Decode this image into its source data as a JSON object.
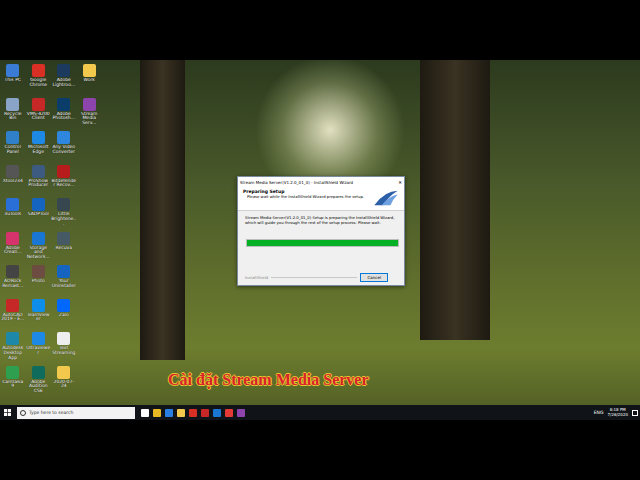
{
  "desktop": {
    "icons": [
      {
        "label": "This PC",
        "color": "#3a7bd5"
      },
      {
        "label": "Recycle Bin",
        "color": "#8aa4c8"
      },
      {
        "label": "Control Panel",
        "color": "#2f80c8"
      },
      {
        "label": "Xtool234",
        "color": "#555555"
      },
      {
        "label": "3uTools",
        "color": "#2a6fd6"
      },
      {
        "label": "Adobe Creati...",
        "color": "#d6336c"
      },
      {
        "label": "AORock Remast...",
        "color": "#444444"
      },
      {
        "label": "AutoCAD 2019 - E...",
        "color": "#c62828"
      },
      {
        "label": "Autodesk Desktop App",
        "color": "#1e88a8"
      },
      {
        "label": "Camtasia 9",
        "color": "#2e9e4f"
      },
      {
        "label": "Google Chrome",
        "color": "#d93025"
      },
      {
        "label": "VMS-4200 Client",
        "color": "#c62828"
      },
      {
        "label": "Microsoft Edge",
        "color": "#1e88e5"
      },
      {
        "label": "ProShow Producer",
        "color": "#3d5a80"
      },
      {
        "label": "SADPTool",
        "color": "#1565c0"
      },
      {
        "label": "Storage and Network...",
        "color": "#1976d2"
      },
      {
        "label": "Photo",
        "color": "#6d4c41"
      },
      {
        "label": "TeamViewer",
        "color": "#0e8ee9"
      },
      {
        "label": "Ultraviewer",
        "color": "#1e88e5"
      },
      {
        "label": "Adobe Audition CS6",
        "color": "#0f6b5c"
      },
      {
        "label": "Adobe Lightroo...",
        "color": "#1c3a5e"
      },
      {
        "label": "Adobe Photosh...",
        "color": "#0b3d6b"
      },
      {
        "label": "Any Video Converter",
        "color": "#2e86de"
      },
      {
        "label": "Bitdefender Recov...",
        "color": "#b71c1c"
      },
      {
        "label": "Little Brightene...",
        "color": "#37474f"
      },
      {
        "label": "Recuva",
        "color": "#455a64"
      },
      {
        "label": "Your Uninstaller",
        "color": "#1565c0"
      },
      {
        "label": "Zalo",
        "color": "#0068ff"
      },
      {
        "label": "Text Streaming",
        "color": "#eeeeee"
      },
      {
        "label": "2020-07-24",
        "color": "#f2c94c"
      },
      {
        "label": "Work",
        "color": "#f2c94c"
      },
      {
        "label": "Stream Media Serv...",
        "color": "#8e44ad"
      }
    ]
  },
  "dialog": {
    "title": "Stream Media Server(V1.2.0_01_0) - InstallShield Wizard",
    "heading": "Preparing Setup",
    "subheading": "Please wait while the InstallShield Wizard prepares the setup.",
    "body": "Stream Media Server(V1.2.0_01_0) Setup is preparing the InstallShield Wizard, which will guide you through the rest of the setup process. Please wait.",
    "progress": {
      "level": 1
    },
    "footer": "InstallShield",
    "buttons": [
      "Cancel"
    ],
    "close": "✕"
  },
  "taskbar": {
    "search": {
      "placeholder": "Type here to search"
    },
    "language": "ENG",
    "time": "8:18 PM",
    "date": "7/26/2020"
  },
  "caption": "Cài đặt Stream Media Server"
}
